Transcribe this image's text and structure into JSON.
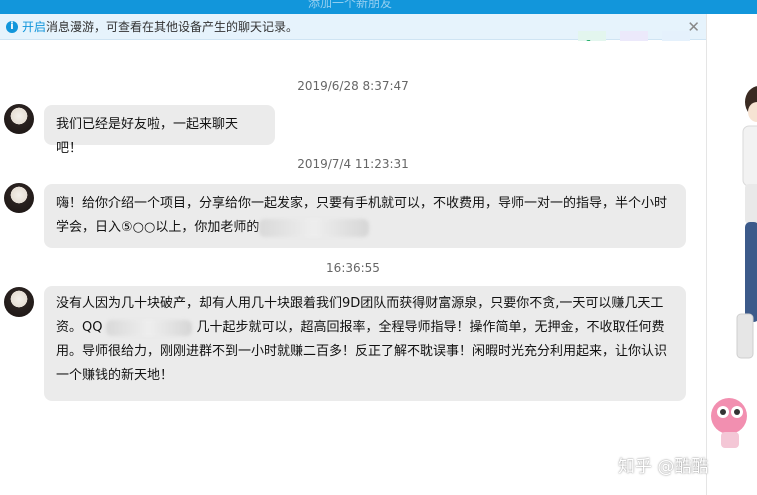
{
  "window": {
    "title": "添加一个新朋友"
  },
  "notice": {
    "link_text": "开启",
    "text": "消息漫游，可查看在其他设备产生的聊天记录。",
    "close_label": "✕"
  },
  "actions": {
    "phone_icon": "phone-icon",
    "video_icon": "video-icon",
    "more_icon": "more-icon"
  },
  "messages": [
    {
      "timestamp": "2019/6/28 8:37:47",
      "text": "我们已经是好友啦，一起来聊天吧！"
    },
    {
      "timestamp": "2019/7/4 11:23:31",
      "line1": "嗨！给你介绍一个项目，分享给你一起发家，只要有手机就可以，不收费用，导师一对一的指导，半个小时",
      "line2": "学会，日入⑤○○以上，你加老师的"
    },
    {
      "timestamp": "16:36:55",
      "line1": "没有人因为几十块破产，却有人用几十块跟着我们9D团队而获得财富源泉，只要你不贪,一天可以赚几天工",
      "line2_pre": "资。QQ",
      "line2_post": "几十起步就可以，超高回报率，全程导师指导！操作简单，无押金，不收取任何费",
      "line3": "用。导师很给力，刚刚进群不到一小时就赚二百多！反正了解不耽误事！闲暇时光充分利用起来，让你认识",
      "line4": "一个赚钱的新天地！"
    }
  ],
  "watermark": "知乎 @酷酷",
  "colors": {
    "accent": "#1296db",
    "bubble": "#ebebeb",
    "notice_bg": "#e6f3fc"
  }
}
